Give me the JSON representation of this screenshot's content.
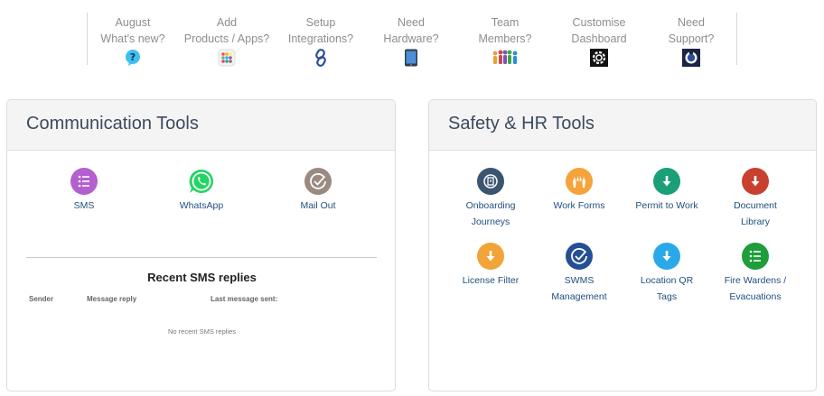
{
  "quick_links": [
    {
      "line1": "August",
      "line2": "What's new?",
      "icon": "question-icon"
    },
    {
      "line1": "Add",
      "line2": "Products / Apps?",
      "icon": "apps-grid-icon"
    },
    {
      "line1": "Setup",
      "line2": "Integrations?",
      "icon": "chain-link-icon"
    },
    {
      "line1": "Need",
      "line2": "Hardware?",
      "icon": "tablet-icon"
    },
    {
      "line1": "Team",
      "line2": "Members?",
      "icon": "people-icon"
    },
    {
      "line1": "Customise",
      "line2": "Dashboard",
      "icon": "gear-icon"
    },
    {
      "line1": "Need",
      "line2": "Support?",
      "icon": "support-icon"
    }
  ],
  "communication": {
    "title": "Communication Tools",
    "tools": [
      {
        "label": "SMS",
        "icon": "sms-list-icon",
        "color": "#b35fcf"
      },
      {
        "label": "WhatsApp",
        "icon": "whatsapp-icon",
        "color": "#25d366"
      },
      {
        "label": "Mail Out",
        "icon": "check-circle-icon",
        "color": "#9a8a80"
      }
    ],
    "replies": {
      "title": "Recent SMS replies",
      "columns": [
        "Sender",
        "Message reply",
        "Last message sent:"
      ],
      "empty": "No recent SMS replies"
    }
  },
  "safety": {
    "title": "Safety & HR Tools",
    "tools": [
      {
        "line1": "Onboarding",
        "line2": "Journeys",
        "icon": "onboarding-icon",
        "color": "#3b5571"
      },
      {
        "line1": "Work Forms",
        "line2": "",
        "icon": "hands-icon",
        "color": "#f5a33a"
      },
      {
        "line1": "Permit to Work",
        "line2": "",
        "icon": "download-arrow-icon",
        "color": "#1a9f78"
      },
      {
        "line1": "Document",
        "line2": "Library",
        "icon": "download-arrow-icon",
        "color": "#c8402f"
      },
      {
        "line1": "License Filter",
        "line2": "",
        "icon": "download-arrow-icon",
        "color": "#f1a438"
      },
      {
        "line1": "SWMS",
        "line2": "Management",
        "icon": "check-circle-icon",
        "color": "#244f96"
      },
      {
        "line1": "Location QR",
        "line2": "Tags",
        "icon": "download-arrow-icon",
        "color": "#2aa9ea"
      },
      {
        "line1": "Fire Wardens /",
        "line2": "Evacuations",
        "icon": "fire-warden-list-icon",
        "color": "#1e9d3a"
      }
    ]
  }
}
